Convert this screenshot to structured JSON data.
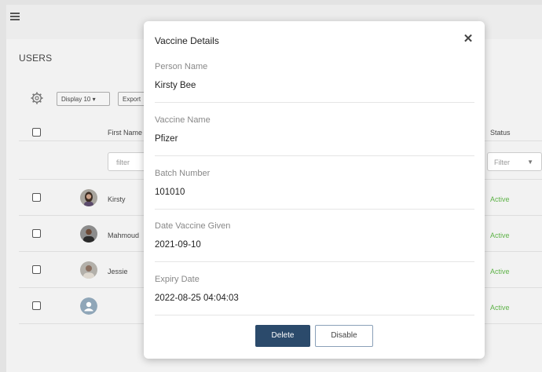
{
  "page": {
    "title": "USERS"
  },
  "toolbar": {
    "display_label": "Display 10 ▾",
    "export_label": "Export"
  },
  "table": {
    "header_first": "First Name",
    "header_status": "Status",
    "filter_placeholder": "filter",
    "status_filter_label": "Filter",
    "rows": [
      {
        "first": "Kirsty",
        "status": "Active"
      },
      {
        "first": "Mahmoud",
        "status": "Active"
      },
      {
        "first": "Jessie",
        "status": "Active"
      },
      {
        "first": "",
        "status": "Active"
      }
    ]
  },
  "modal": {
    "title": "Vaccine Details",
    "close_glyph": "✕",
    "fields": [
      {
        "label": "Person Name",
        "value": "Kirsty Bee"
      },
      {
        "label": "Vaccine Name",
        "value": "Pfizer"
      },
      {
        "label": "Batch Number",
        "value": "101010"
      },
      {
        "label": "Date Vaccine Given",
        "value": "2021-09-10"
      },
      {
        "label": "Expiry Date",
        "value": "2022-08-25 04:04:03"
      }
    ],
    "delete_label": "Delete",
    "disable_label": "Disable"
  },
  "colors": {
    "primary": "#2b4a6b",
    "status_active": "#5fb349"
  }
}
